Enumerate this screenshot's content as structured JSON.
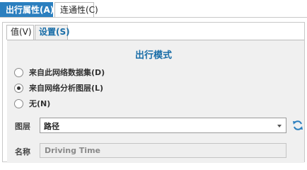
{
  "top_tabs": {
    "travel_attributes": "出行属性(A)",
    "connectivity": "连通性(C)"
  },
  "sub_tabs": {
    "values": "值(V)",
    "settings": "设置(S)"
  },
  "section": {
    "title": "出行模式"
  },
  "radio_options": [
    {
      "label": "来自此网络数据集(D)",
      "selected": false
    },
    {
      "label": "来自网络分析图层(L)",
      "selected": true
    },
    {
      "label": "无(N)",
      "selected": false
    }
  ],
  "layer": {
    "label": "图层",
    "value": "路径"
  },
  "name": {
    "label": "名称",
    "value": "Driving Time"
  },
  "colors": {
    "accent": "#2b7fbf",
    "section_title": "#1a6ea8",
    "panel_bg": "#f0f0f0"
  }
}
